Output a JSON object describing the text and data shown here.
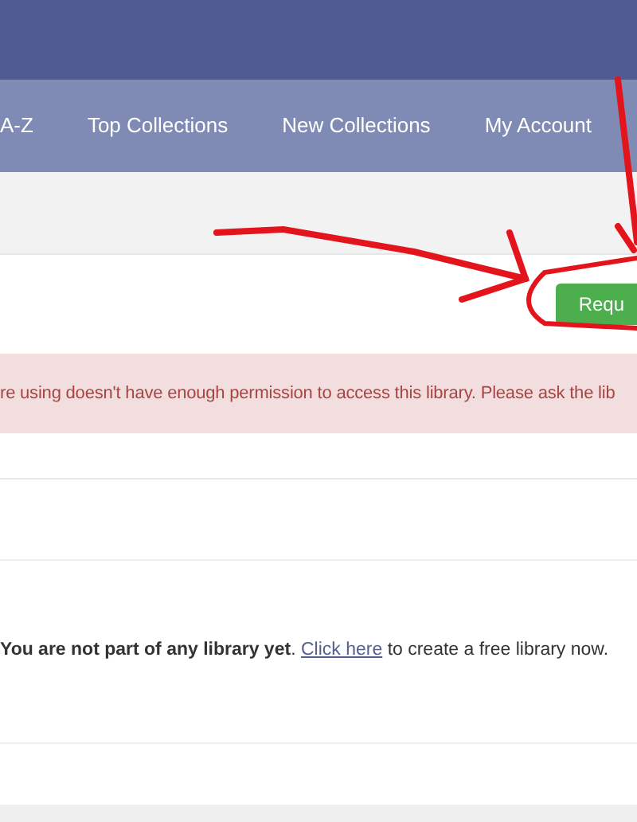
{
  "nav": {
    "items": [
      {
        "label": "A-Z"
      },
      {
        "label": "Top Collections"
      },
      {
        "label": "New Collections"
      },
      {
        "label": "My Account"
      }
    ]
  },
  "request_button": {
    "label": "Requ"
  },
  "alert": {
    "text": "re using doesn't have enough permission to access this library. Please ask the lib"
  },
  "message": {
    "text": "**You are not part of any library yet**.",
    "link": "Click here",
    "after": "to create a free library now."
  }
}
